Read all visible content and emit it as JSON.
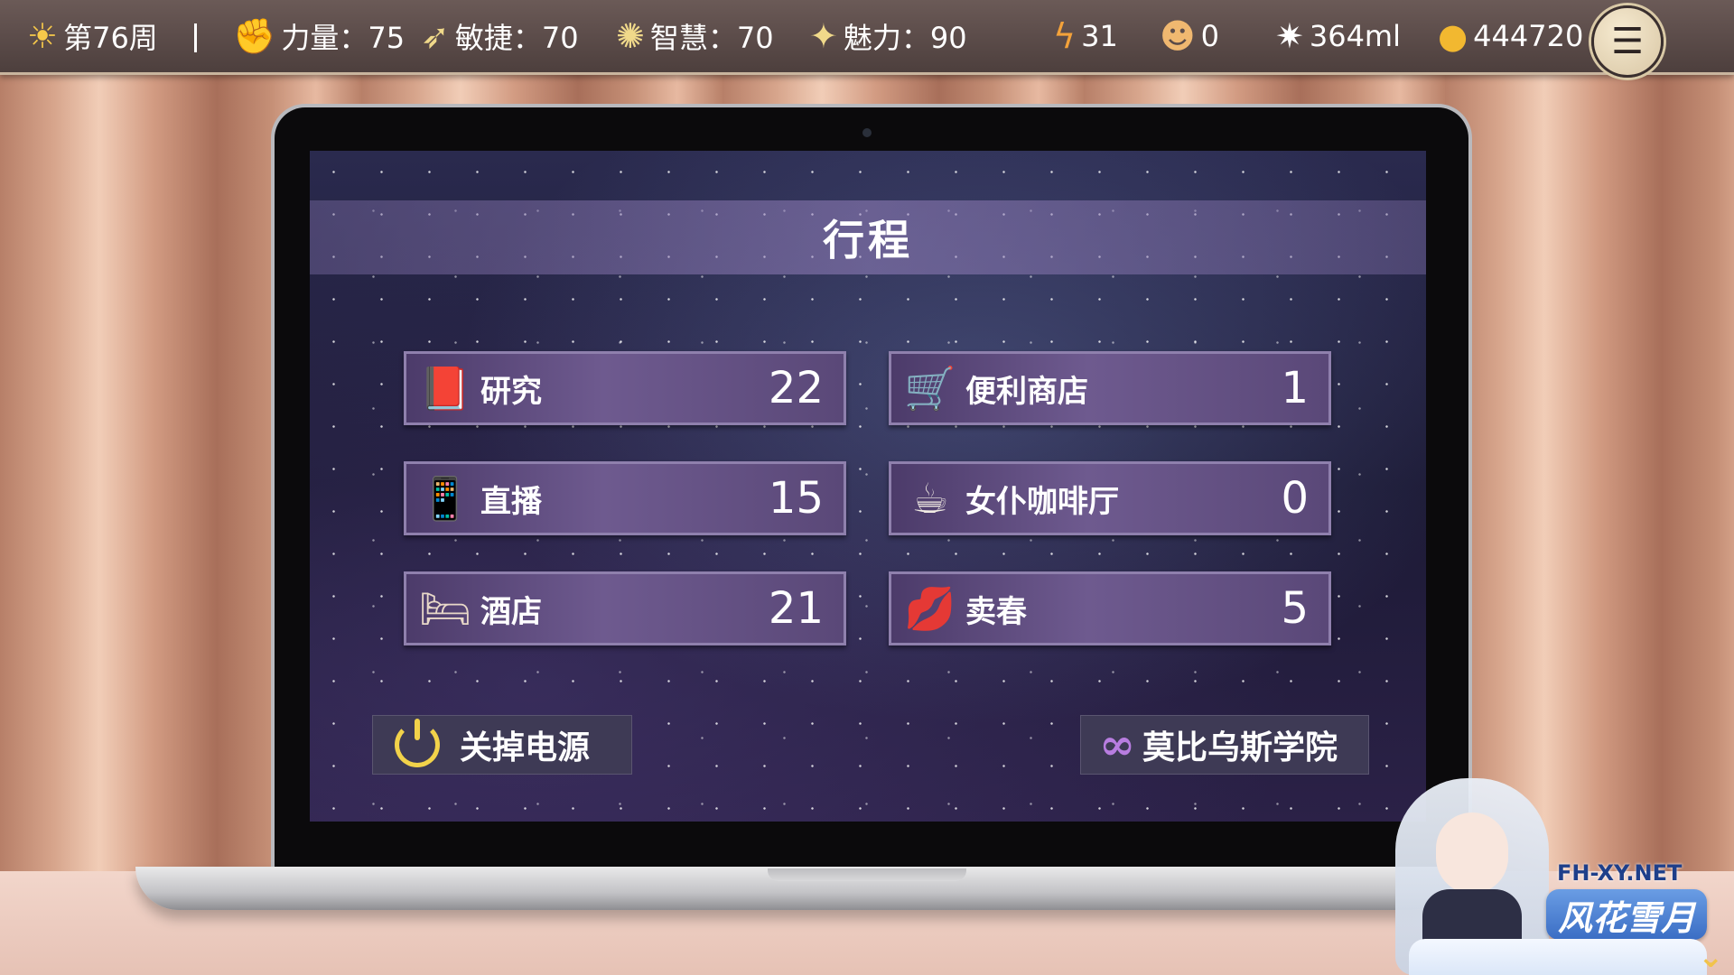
{
  "status_bar": {
    "week": "第76周",
    "strength": "力量：75",
    "agility": "敏捷：70",
    "wisdom": "智慧：70",
    "charm": "魅力：90",
    "energy": "31",
    "followers": "0",
    "volume": "364ml",
    "money": "444720"
  },
  "panel": {
    "title": "行程",
    "items": [
      {
        "label": "研究",
        "count": "22",
        "icon": "research-book-icon"
      },
      {
        "label": "便利商店",
        "count": "1",
        "icon": "shopping-cart-icon"
      },
      {
        "label": "直播",
        "count": "15",
        "icon": "smartphone-icon"
      },
      {
        "label": "女仆咖啡厅",
        "count": "0",
        "icon": "coffee-cup-icon"
      },
      {
        "label": "酒店",
        "count": "21",
        "icon": "bed-icon"
      },
      {
        "label": "卖春",
        "count": "5",
        "icon": "lips-icon"
      }
    ],
    "power_button": "关掉电源",
    "school_button": "莫比乌斯学院"
  },
  "watermark": {
    "site": "FH-XY.NET",
    "name": "风花雪月"
  }
}
